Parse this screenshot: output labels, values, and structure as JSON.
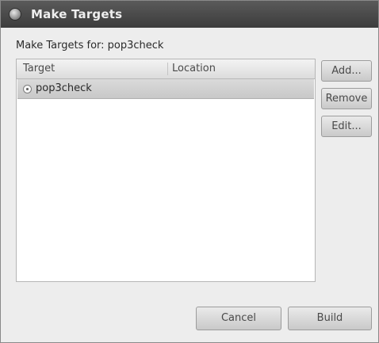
{
  "window": {
    "title": "Make Targets"
  },
  "dialog": {
    "prompt": "Make Targets for: pop3check"
  },
  "table": {
    "columns": [
      "Target",
      "Location"
    ],
    "rows": [
      {
        "target": "pop3check",
        "location": ""
      }
    ]
  },
  "side_buttons": {
    "add": "Add...",
    "remove": "Remove",
    "edit": "Edit..."
  },
  "bottom_buttons": {
    "cancel": "Cancel",
    "build": "Build"
  },
  "icons": {
    "window": "app-icon",
    "row": "target-icon"
  }
}
